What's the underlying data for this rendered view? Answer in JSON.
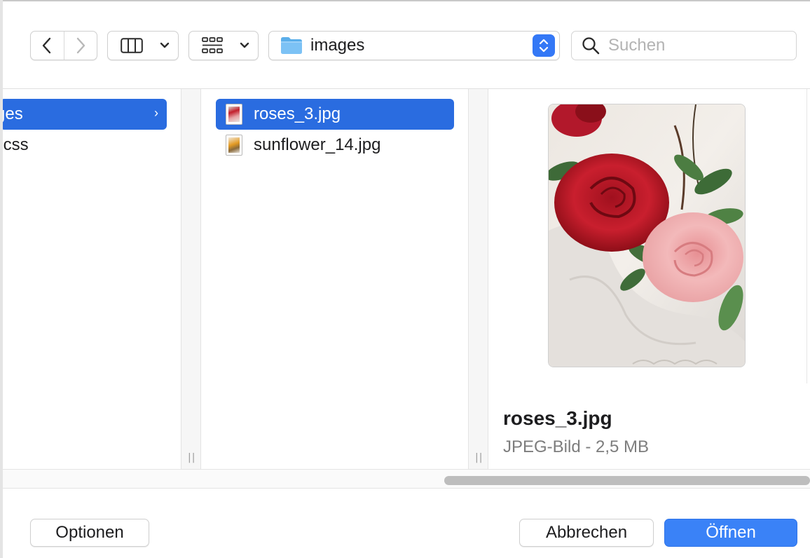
{
  "toolbar": {
    "location": "images",
    "search_placeholder": "Suchen"
  },
  "columns": {
    "parent": [
      {
        "label": "ges",
        "selected": true
      },
      {
        "label": ".css",
        "selected": false
      }
    ],
    "files": [
      {
        "label": "roses_3.jpg",
        "selected": true,
        "thumb": "roses-thumbnail"
      },
      {
        "label": "sunflower_14.jpg",
        "selected": false,
        "thumb": "sunflower-thumbnail"
      }
    ]
  },
  "preview": {
    "name": "roses_3.jpg",
    "meta": "JPEG-Bild - 2,5 MB"
  },
  "buttons": {
    "options": "Optionen",
    "cancel": "Abbrechen",
    "open": "Öffnen"
  },
  "colors": {
    "accent": "#3478f6",
    "selection": "#2a6ce0",
    "open_button": "#3a82f7"
  },
  "icons": [
    "back-arrow-icon",
    "forward-arrow-icon",
    "column-view-icon",
    "chevron-down-icon",
    "group-grid-icon",
    "folder-icon",
    "stepper-icon",
    "search-icon",
    "chevron-right-icon"
  ]
}
